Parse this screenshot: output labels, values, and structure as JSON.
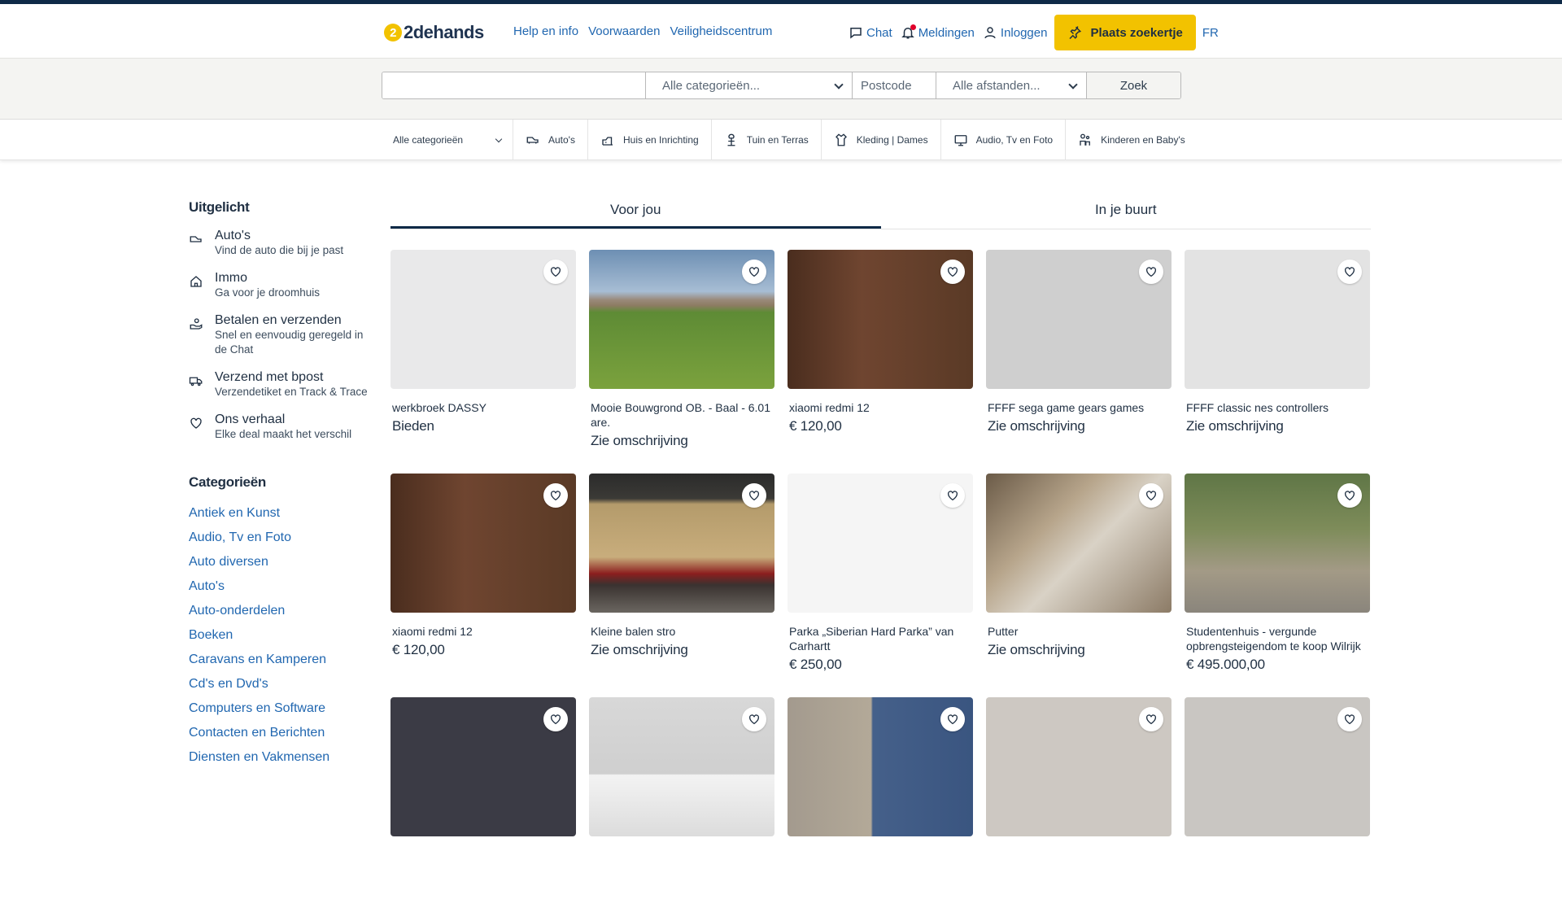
{
  "header": {
    "logo_text": "2dehands",
    "links": [
      "Help en info",
      "Voorwaarden",
      "Veiligheidscentrum"
    ],
    "chat": "Chat",
    "notifications": "Meldingen",
    "login": "Inloggen",
    "place_ad": "Plaats zoekertje",
    "lang": "FR",
    "accent_color": "#f2c200"
  },
  "search": {
    "query_placeholder": "",
    "category": "Alle categorieën...",
    "postcode_placeholder": "Postcode",
    "distance": "Alle afstanden...",
    "submit": "Zoek"
  },
  "catbar": {
    "first": "Alle categorieën",
    "items": [
      {
        "label": "Auto's",
        "icon": "car-icon"
      },
      {
        "label": "Huis en Inrichting",
        "icon": "house-icon"
      },
      {
        "label": "Tuin en Terras",
        "icon": "garden-icon"
      },
      {
        "label": "Kleding | Dames",
        "icon": "clothing-icon"
      },
      {
        "label": "Audio, Tv en Foto",
        "icon": "tv-icon"
      },
      {
        "label": "Kinderen en Baby's",
        "icon": "baby-icon"
      }
    ]
  },
  "sidebar": {
    "featured_heading": "Uitgelicht",
    "featured": [
      {
        "title": "Auto's",
        "sub": "Vind de auto die bij je past",
        "icon": "car-icon"
      },
      {
        "title": "Immo",
        "sub": "Ga voor je droomhuis",
        "icon": "home-icon"
      },
      {
        "title": "Betalen en verzenden",
        "sub": "Snel en eenvoudig geregeld in de Chat",
        "icon": "payment-hand-icon"
      },
      {
        "title": "Verzend met bpost",
        "sub": "Verzendetiket en Track & Trace",
        "icon": "delivery-truck-icon"
      },
      {
        "title": "Ons verhaal",
        "sub": "Elke deal maakt het verschil",
        "icon": "heart-icon"
      }
    ],
    "categories_heading": "Categorieën",
    "categories": [
      "Antiek en Kunst",
      "Audio, Tv en Foto",
      "Auto diversen",
      "Auto's",
      "Auto-onderdelen",
      "Boeken",
      "Caravans en Kamperen",
      "Cd's en Dvd's",
      "Computers en Software",
      "Contacten en Berichten",
      "Diensten en Vakmensen"
    ]
  },
  "tabs": [
    "Voor jou",
    "In je buurt"
  ],
  "listings": [
    {
      "title": "werkbroek DASSY",
      "price": "Bieden",
      "img": "im-pants"
    },
    {
      "title": "Mooie Bouwgrond OB. - Baal - 6.01 are.",
      "price": "Zie omschrijving",
      "img": "im-field"
    },
    {
      "title": "xiaomi redmi 12",
      "price": "€ 120,00",
      "img": "im-phone"
    },
    {
      "title": "FFFF sega game gears games",
      "price": "Zie omschrijving",
      "img": "im-sega"
    },
    {
      "title": "FFFF classic nes controllers",
      "price": "Zie omschrijving",
      "img": "im-nes"
    },
    {
      "title": "xiaomi redmi 12",
      "price": "€ 120,00",
      "img": "im-phone2"
    },
    {
      "title": "Kleine balen stro",
      "price": "Zie omschrijving",
      "img": "im-hay"
    },
    {
      "title": "Parka „Siberian Hard Parka” van Carhartt",
      "price": "€ 250,00",
      "img": "im-coat"
    },
    {
      "title": "Putter",
      "price": "Zie omschrijving",
      "img": "im-bird"
    },
    {
      "title": "Studentenhuis - vergunde opbrengsteigendom te koop Wilrijk",
      "price": "€ 495.000,00",
      "img": "im-garden"
    },
    {
      "title": "",
      "price": "",
      "img": "im-carts"
    },
    {
      "title": "",
      "price": "",
      "img": "im-shelf"
    },
    {
      "title": "",
      "price": "",
      "img": "im-jeans"
    },
    {
      "title": "",
      "price": "",
      "img": "im-finch"
    },
    {
      "title": "",
      "price": "",
      "img": "im-gameboy"
    }
  ]
}
